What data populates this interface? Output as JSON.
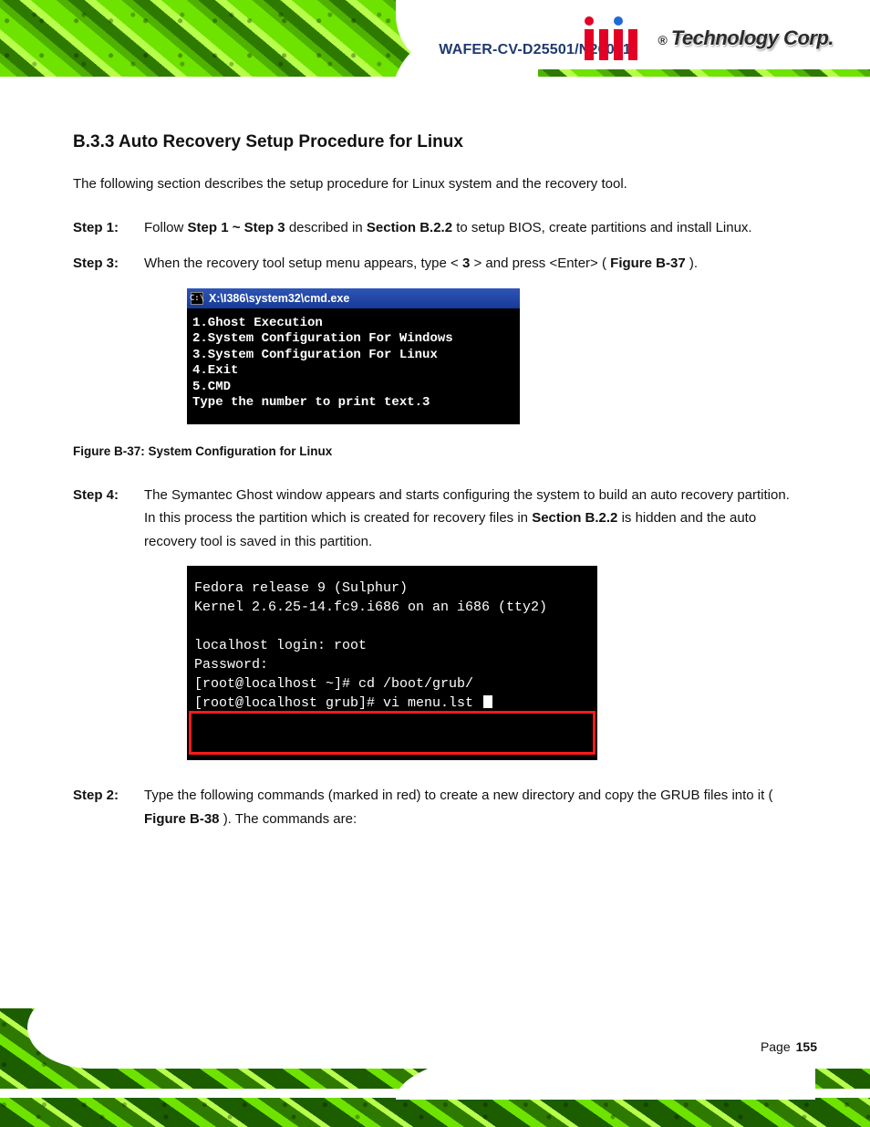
{
  "header": {
    "doc_title": "WAFER-CV-D25501/N26001",
    "brand_registered": "®",
    "brand_text": "Technology Corp."
  },
  "section": {
    "number": "B.3.3",
    "title": "Auto Recovery Setup Procedure for Linux"
  },
  "intro": "The following section describes the setup procedure for Linux system and the recovery tool.",
  "steps": {
    "s1": {
      "label": "Step 1:",
      "text_a": "Follow ",
      "bold_a": "Step 1 ~ Step 3",
      "text_b": " described in ",
      "bold_b": "Section B.2.2",
      "text_c": " to setup BIOS, create partitions and install Linux."
    },
    "s2": {
      "label": "Step 2:",
      "text_a": "Type the following commands (marked in red) to create a new directory and copy the GRUB files into it (",
      "bold_a": "Figure B-38",
      "text_b": "). The commands are:"
    },
    "s3": {
      "label": "Step 3:",
      "text_a": "When the recovery tool setup menu appears, type <",
      "bold_a": "3",
      "text_b": "> and press <Enter> (",
      "bold_b": "Figure B-37",
      "text_c": ")."
    },
    "s4": {
      "label": "Step 4:",
      "text_a": "The Symantec Ghost window appears and starts configuring the system to build an auto recovery partition. In this process the partition which is created for recovery files in ",
      "bold_a": "Section B.2.2",
      "text_b": " is hidden and the auto recovery tool is saved in this partition."
    }
  },
  "term1": {
    "path": "X:\\I386\\system32\\cmd.exe",
    "lines": [
      "1.Ghost Execution",
      "2.System Configuration For Windows",
      "3.System Configuration For Linux",
      "4.Exit",
      "5.CMD",
      "Type the number to print text.3"
    ]
  },
  "caption1": "Figure B-37: System Configuration for Linux",
  "term2": {
    "lines": [
      "Fedora release 9 (Sulphur)",
      "Kernel 2.6.25-14.fc9.i686 on an i686 (tty2)",
      "",
      "localhost login: root",
      "Password:",
      "[root@localhost ~]# cd /boot/grub/",
      "[root@localhost grub]# vi menu.lst "
    ]
  },
  "footer": {
    "page_text": "Page",
    "page_no": "155"
  }
}
